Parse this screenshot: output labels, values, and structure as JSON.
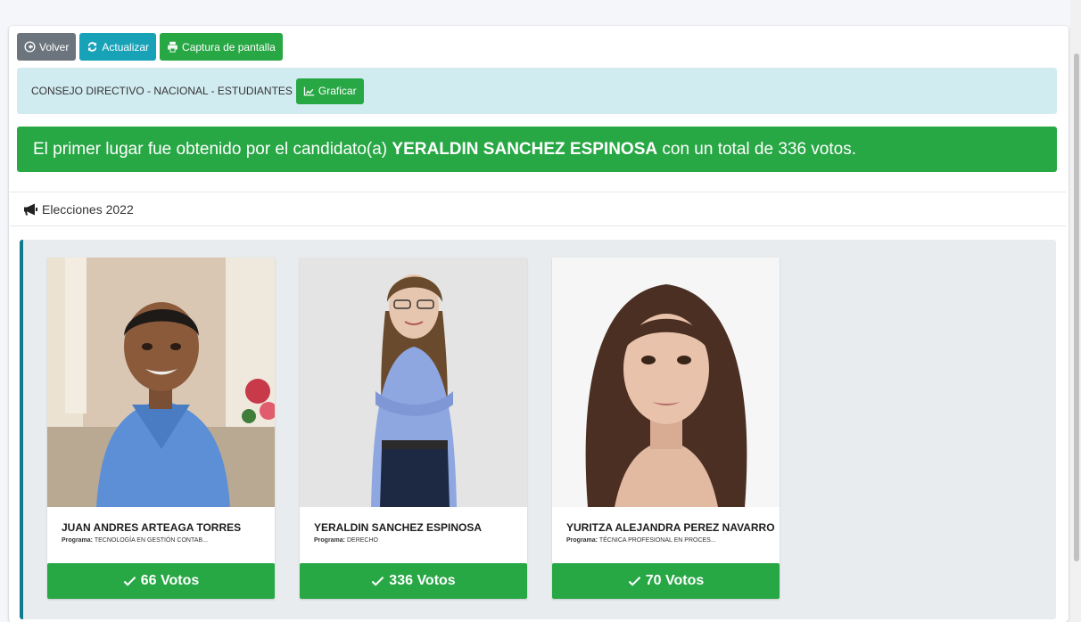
{
  "toolbar": {
    "back_label": "Volver",
    "refresh_label": "Actualizar",
    "screenshot_label": "Captura de pantalla"
  },
  "info": {
    "title": "CONSEJO DIRECTIVO - NACIONAL - ESTUDIANTES",
    "chart_label": "Graficar"
  },
  "winner": {
    "prefix": "El primer lugar fue obtenido por el candidato(a)",
    "name": "YERALDIN SANCHEZ ESPINOSA",
    "suffix": "con un total de 336 votos."
  },
  "elections": {
    "header": "Elecciones 2022"
  },
  "candidates": [
    {
      "name": "JUAN ANDRES ARTEAGA TORRES",
      "program_label": "Programa:",
      "program": "TECNOLOGÍA EN GESTIÓN CONTAB...",
      "votes_label": "66 Votos"
    },
    {
      "name": "YERALDIN SANCHEZ ESPINOSA",
      "program_label": "Programa:",
      "program": "DERECHO",
      "votes_label": "336 Votos"
    },
    {
      "name": "YURITZA ALEJANDRA PEREZ NAVARRO",
      "program_label": "Programa:",
      "program": "TÉCNICA PROFESIONAL EN PROCES...",
      "votes_label": "70 Votos"
    }
  ],
  "colors": {
    "success": "#28a745",
    "info": "#17a2b8",
    "secondary": "#6c757d",
    "alert_bg": "#d1ecf1",
    "accent_border": "#117a8b"
  }
}
